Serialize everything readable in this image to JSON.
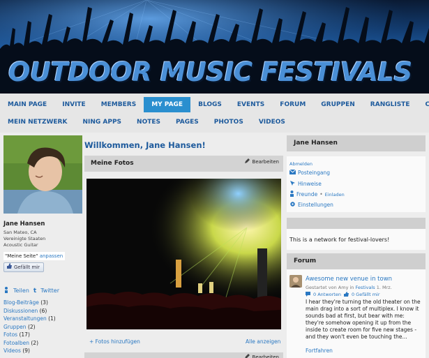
{
  "banner": {
    "title": "OUTDOOR MUSIC FESTIVALS"
  },
  "nav": {
    "row1": [
      "MAIN PAGE",
      "INVITE",
      "MEMBERS",
      "MY PAGE",
      "BLOGS",
      "EVENTS",
      "FORUM",
      "GRUPPEN",
      "RANGLISTE",
      "CHAT"
    ],
    "row2": [
      "MEIN NETZWERK",
      "NING APPS",
      "NOTES",
      "PAGES",
      "PHOTOS",
      "VIDEOS"
    ],
    "active": "MY PAGE"
  },
  "profile": {
    "name": "Jane Hansen",
    "location": "San Mateo, CA",
    "country": "Vereinigte Staaten",
    "genre": "Acoustic Guitar",
    "my_page_label": "\"Meine Seite\"",
    "customize_label": "anpassen",
    "like_label": "Gefällt mir",
    "share_label": "Teilen",
    "twitter_label": "Twitter",
    "counts": [
      {
        "label": "Blog-Beiträge",
        "count": "(3)"
      },
      {
        "label": "Diskussionen",
        "count": "(6)"
      },
      {
        "label": "Veranstaltungen",
        "count": "(1)"
      },
      {
        "label": "Gruppen",
        "count": "(2)"
      },
      {
        "label": "Fotos",
        "count": "(17)"
      },
      {
        "label": "Fotoalben",
        "count": "(2)"
      },
      {
        "label": "Videos",
        "count": "(9)"
      }
    ]
  },
  "main": {
    "welcome": "Willkommen, Jane Hansen!",
    "photos_title": "Meine Fotos",
    "edit_label": "Bearbeiten",
    "add_photos": "+ Fotos hinzufügen",
    "view_all": "Alle anzeigen"
  },
  "user_box": {
    "title": "Jane Hansen",
    "logout": "Abmelden",
    "inbox": "Posteingang",
    "alerts": "Hinweise",
    "friends": "Freunde",
    "invite": "Einladen",
    "settings": "Einstellungen"
  },
  "about": {
    "text": "This is a network for festival-lovers!"
  },
  "forum": {
    "title": "Forum",
    "topic_title": "Awesome new venue in town",
    "started_by": "Gestartet von Amy in",
    "category": "Festivals",
    "date": "1. Mrz.",
    "replies": "0 Antworten",
    "likes": "0 Gefällt mir",
    "body": "I hear they're turning the old theater on the main drag into a sort of multiplex. I know it sounds bad at first, but bear with me: they're somehow opening it up from the inside to create room for five new stages - and they won't even be touching the...",
    "continue": "Fortfahren"
  },
  "colors": {
    "link": "#2a78c2",
    "nav_active": "#2a8fcf",
    "heading": "#1d5a9c"
  }
}
